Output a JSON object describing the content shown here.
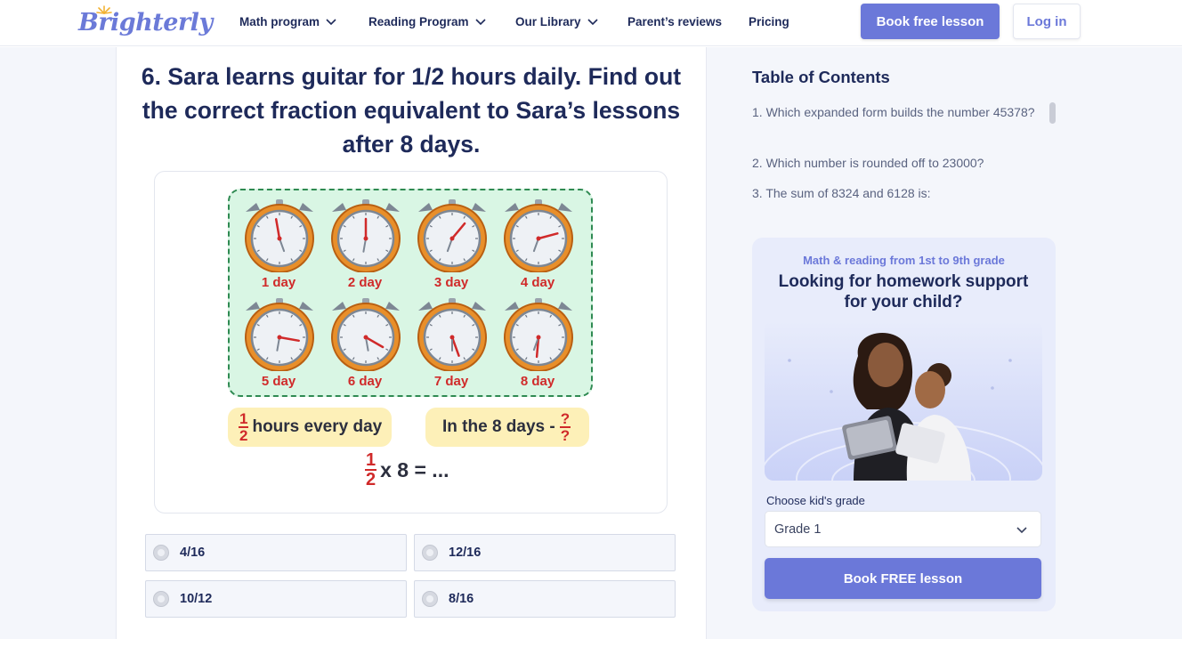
{
  "header": {
    "logo": "Brighterly",
    "nav": [
      {
        "label": "Math program",
        "has_dropdown": true
      },
      {
        "label": "Reading Program",
        "has_dropdown": true
      },
      {
        "label": "Our Library",
        "has_dropdown": true
      },
      {
        "label": "Parent’s reviews",
        "has_dropdown": false
      },
      {
        "label": "Pricing",
        "has_dropdown": false
      }
    ],
    "book_label": "Book free lesson",
    "login_label": "Log in"
  },
  "question": {
    "text": "6. Sara learns guitar for 1/2 hours daily. Find out the correct fraction equivalent to Sara’s lessons after 8 days."
  },
  "illustration": {
    "day_labels": [
      "1 day",
      "2 day",
      "3 day",
      "4 day",
      "5 day",
      "6 day",
      "7 day",
      "8 day"
    ],
    "pill_left": {
      "num": "1",
      "den": "2",
      "text": "hours every day"
    },
    "pill_right": {
      "text": "In the 8 days -",
      "num": "?",
      "den": "?"
    },
    "equation": {
      "num": "1",
      "den": "2",
      "rest": "x 8 = ..."
    }
  },
  "options": [
    "4/16",
    "12/16",
    "10/12",
    "8/16"
  ],
  "sidebar": {
    "toc_title": "Table of Contents",
    "toc_items": [
      "1. Which expanded form builds the number 45378?",
      "2. Which number is rounded off to 23000?",
      "3. The sum of 8324 and 6128 is:"
    ],
    "promo": {
      "subtitle": "Math & reading from 1st to 9th grade",
      "title": "Looking for homework support for your child?",
      "grade_label": "Choose kid's grade",
      "grade_value": "Grade 1",
      "button": "Book FREE lesson"
    }
  },
  "colors": {
    "brand": "#6b78d9",
    "navy": "#1e2a5a",
    "clock_bg": "#d9f6e4",
    "accent_red": "#d02a2a",
    "pill_yellow": "#fdf0b8"
  }
}
